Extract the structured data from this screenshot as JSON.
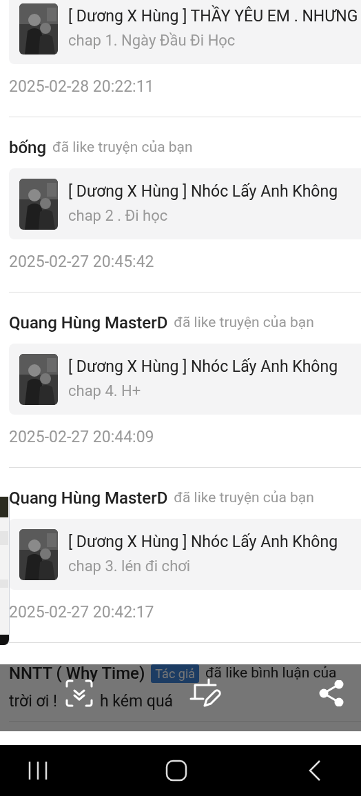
{
  "notifications": [
    {
      "story": "[ Dương X Hùng ] THẦY YÊU EM . NHƯNG",
      "chapter": "chap 1. Ngày Đầu Đi Học",
      "time": "2025-02-28 20:22:11"
    },
    {
      "user": "bống",
      "action": "đã like truyện của bạn",
      "story": "[ Dương X Hùng ] Nhóc Lấy Anh Không",
      "chapter": "chap 2 . Đi học",
      "time": "2025-02-27 20:45:42"
    },
    {
      "user": "Quang Hùng MasterD",
      "action": "đã like truyện của bạn",
      "story": "[ Dương X Hùng ] Nhóc Lấy Anh Không",
      "chapter": "chap 4. H+",
      "time": "2025-02-27 20:44:09"
    },
    {
      "user": "Quang Hùng MasterD",
      "action": "đã like truyện của bạn",
      "story": "[ Dương X Hùng ] Nhóc Lấy Anh Không",
      "chapter": "chap 3. lén đi chơi",
      "time": "2025-02-27 20:42:17"
    },
    {
      "user": "NNTT ( Why Time)",
      "badge": "Tác giả",
      "action": "đã like bình luận của",
      "comment_fragments": [
        "trời ơi !",
        "h kém quá"
      ]
    }
  ]
}
